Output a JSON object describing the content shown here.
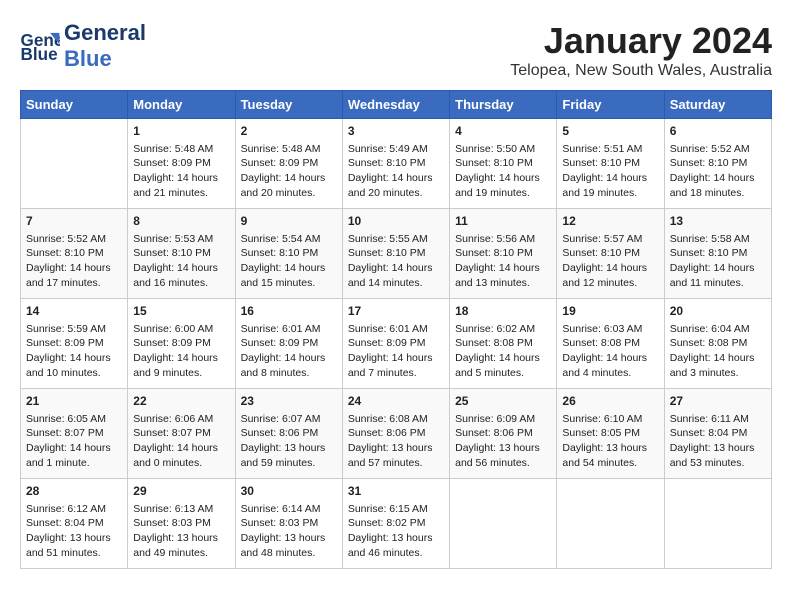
{
  "header": {
    "logo_line1": "General",
    "logo_line2": "Blue",
    "title": "January 2024",
    "subtitle": "Telopea, New South Wales, Australia"
  },
  "calendar": {
    "days_of_week": [
      "Sunday",
      "Monday",
      "Tuesday",
      "Wednesday",
      "Thursday",
      "Friday",
      "Saturday"
    ],
    "weeks": [
      [
        {
          "num": "",
          "content": ""
        },
        {
          "num": "1",
          "content": "Sunrise: 5:48 AM\nSunset: 8:09 PM\nDaylight: 14 hours\nand 21 minutes."
        },
        {
          "num": "2",
          "content": "Sunrise: 5:48 AM\nSunset: 8:09 PM\nDaylight: 14 hours\nand 20 minutes."
        },
        {
          "num": "3",
          "content": "Sunrise: 5:49 AM\nSunset: 8:10 PM\nDaylight: 14 hours\nand 20 minutes."
        },
        {
          "num": "4",
          "content": "Sunrise: 5:50 AM\nSunset: 8:10 PM\nDaylight: 14 hours\nand 19 minutes."
        },
        {
          "num": "5",
          "content": "Sunrise: 5:51 AM\nSunset: 8:10 PM\nDaylight: 14 hours\nand 19 minutes."
        },
        {
          "num": "6",
          "content": "Sunrise: 5:52 AM\nSunset: 8:10 PM\nDaylight: 14 hours\nand 18 minutes."
        }
      ],
      [
        {
          "num": "7",
          "content": "Sunrise: 5:52 AM\nSunset: 8:10 PM\nDaylight: 14 hours\nand 17 minutes."
        },
        {
          "num": "8",
          "content": "Sunrise: 5:53 AM\nSunset: 8:10 PM\nDaylight: 14 hours\nand 16 minutes."
        },
        {
          "num": "9",
          "content": "Sunrise: 5:54 AM\nSunset: 8:10 PM\nDaylight: 14 hours\nand 15 minutes."
        },
        {
          "num": "10",
          "content": "Sunrise: 5:55 AM\nSunset: 8:10 PM\nDaylight: 14 hours\nand 14 minutes."
        },
        {
          "num": "11",
          "content": "Sunrise: 5:56 AM\nSunset: 8:10 PM\nDaylight: 14 hours\nand 13 minutes."
        },
        {
          "num": "12",
          "content": "Sunrise: 5:57 AM\nSunset: 8:10 PM\nDaylight: 14 hours\nand 12 minutes."
        },
        {
          "num": "13",
          "content": "Sunrise: 5:58 AM\nSunset: 8:10 PM\nDaylight: 14 hours\nand 11 minutes."
        }
      ],
      [
        {
          "num": "14",
          "content": "Sunrise: 5:59 AM\nSunset: 8:09 PM\nDaylight: 14 hours\nand 10 minutes."
        },
        {
          "num": "15",
          "content": "Sunrise: 6:00 AM\nSunset: 8:09 PM\nDaylight: 14 hours\nand 9 minutes."
        },
        {
          "num": "16",
          "content": "Sunrise: 6:01 AM\nSunset: 8:09 PM\nDaylight: 14 hours\nand 8 minutes."
        },
        {
          "num": "17",
          "content": "Sunrise: 6:01 AM\nSunset: 8:09 PM\nDaylight: 14 hours\nand 7 minutes."
        },
        {
          "num": "18",
          "content": "Sunrise: 6:02 AM\nSunset: 8:08 PM\nDaylight: 14 hours\nand 5 minutes."
        },
        {
          "num": "19",
          "content": "Sunrise: 6:03 AM\nSunset: 8:08 PM\nDaylight: 14 hours\nand 4 minutes."
        },
        {
          "num": "20",
          "content": "Sunrise: 6:04 AM\nSunset: 8:08 PM\nDaylight: 14 hours\nand 3 minutes."
        }
      ],
      [
        {
          "num": "21",
          "content": "Sunrise: 6:05 AM\nSunset: 8:07 PM\nDaylight: 14 hours\nand 1 minute."
        },
        {
          "num": "22",
          "content": "Sunrise: 6:06 AM\nSunset: 8:07 PM\nDaylight: 14 hours\nand 0 minutes."
        },
        {
          "num": "23",
          "content": "Sunrise: 6:07 AM\nSunset: 8:06 PM\nDaylight: 13 hours\nand 59 minutes."
        },
        {
          "num": "24",
          "content": "Sunrise: 6:08 AM\nSunset: 8:06 PM\nDaylight: 13 hours\nand 57 minutes."
        },
        {
          "num": "25",
          "content": "Sunrise: 6:09 AM\nSunset: 8:06 PM\nDaylight: 13 hours\nand 56 minutes."
        },
        {
          "num": "26",
          "content": "Sunrise: 6:10 AM\nSunset: 8:05 PM\nDaylight: 13 hours\nand 54 minutes."
        },
        {
          "num": "27",
          "content": "Sunrise: 6:11 AM\nSunset: 8:04 PM\nDaylight: 13 hours\nand 53 minutes."
        }
      ],
      [
        {
          "num": "28",
          "content": "Sunrise: 6:12 AM\nSunset: 8:04 PM\nDaylight: 13 hours\nand 51 minutes."
        },
        {
          "num": "29",
          "content": "Sunrise: 6:13 AM\nSunset: 8:03 PM\nDaylight: 13 hours\nand 49 minutes."
        },
        {
          "num": "30",
          "content": "Sunrise: 6:14 AM\nSunset: 8:03 PM\nDaylight: 13 hours\nand 48 minutes."
        },
        {
          "num": "31",
          "content": "Sunrise: 6:15 AM\nSunset: 8:02 PM\nDaylight: 13 hours\nand 46 minutes."
        },
        {
          "num": "",
          "content": ""
        },
        {
          "num": "",
          "content": ""
        },
        {
          "num": "",
          "content": ""
        }
      ]
    ]
  }
}
